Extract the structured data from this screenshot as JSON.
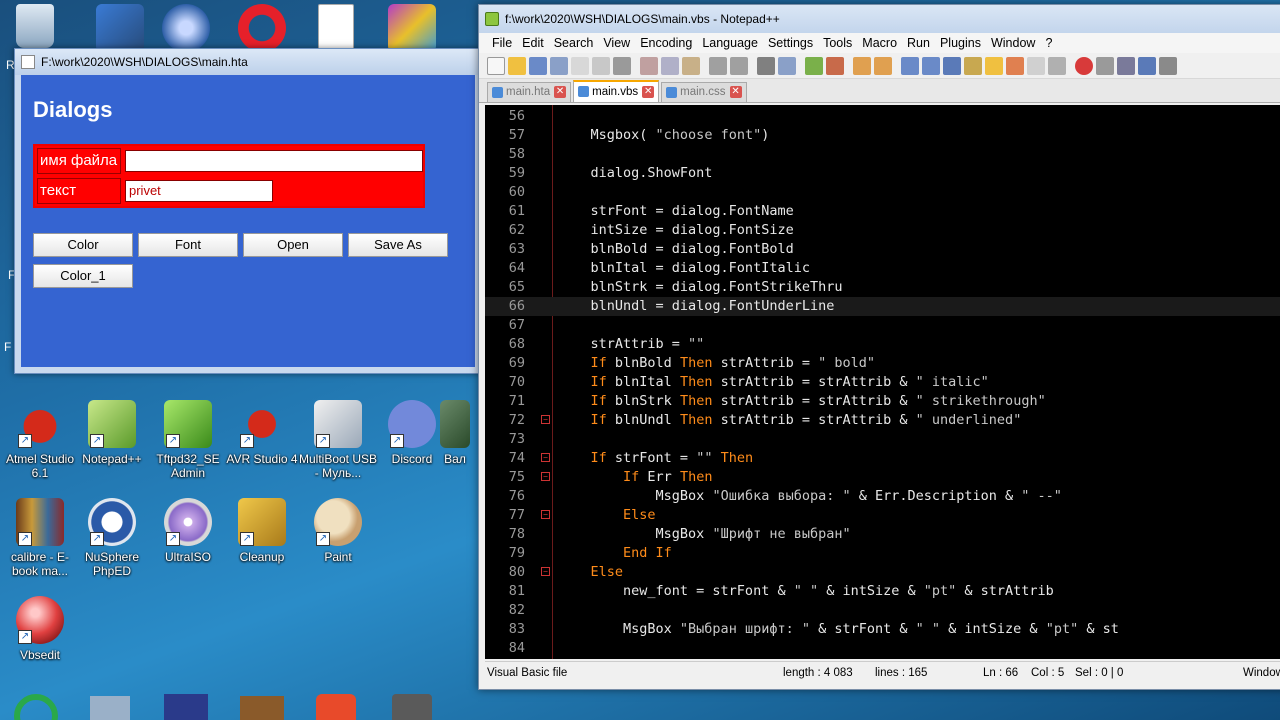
{
  "colors": {
    "hta_bg": "#3564d1",
    "form_red": "#ff0000",
    "keyword": "#ff8c1a",
    "editor_bg": "#000000"
  },
  "desktop": {
    "top_partial": [
      "R",
      "F",
      "F"
    ],
    "icons": [
      {
        "label": "Atmel Studio 6.1",
        "icon": "ladybug-icon"
      },
      {
        "label": "Notepad++",
        "icon": "notepadpp-icon"
      },
      {
        "label": "Tftpd32_SE Admin",
        "icon": "tftp-icon"
      },
      {
        "label": "AVR Studio 4",
        "icon": "bug-icon"
      },
      {
        "label": "MultiBoot USB - Муль...",
        "icon": "usb-icon"
      },
      {
        "label": "Discord",
        "icon": "discord-icon"
      },
      {
        "label": "Вал",
        "icon": "app-icon"
      },
      {
        "label": "calibre - E-book ma...",
        "icon": "books-icon"
      },
      {
        "label": "NuSphere PhpED",
        "icon": "phped-icon"
      },
      {
        "label": "UltraISO",
        "icon": "disc-icon"
      },
      {
        "label": "Cleanup",
        "icon": "broom-icon"
      },
      {
        "label": "Paint",
        "icon": "palette-icon"
      },
      {
        "label": "Vbsedit",
        "icon": "ball-icon"
      }
    ]
  },
  "hta": {
    "title": "F:\\work\\2020\\WSH\\DIALOGS\\main.hta",
    "heading": "Dialogs",
    "rows": [
      {
        "label": "имя файла",
        "value": ""
      },
      {
        "label": "текст",
        "value": "privet"
      }
    ],
    "buttons": [
      "Color",
      "Font",
      "Open",
      "Save As",
      "Color_1"
    ]
  },
  "npp": {
    "title": "f:\\work\\2020\\WSH\\DIALOGS\\main.vbs - Notepad++",
    "menu": [
      "File",
      "Edit",
      "Search",
      "View",
      "Encoding",
      "Language",
      "Settings",
      "Tools",
      "Macro",
      "Run",
      "Plugins",
      "Window",
      "?"
    ],
    "tabs": [
      "main.hta",
      "main.vbs",
      "main.css"
    ],
    "status": {
      "type": "Visual Basic file",
      "length": "length : 4 083",
      "lines": "lines : 165",
      "ln": "Ln : 66",
      "col": "Col : 5",
      "sel": "Sel : 0 | 0",
      "eol": "Windows"
    }
  }
}
